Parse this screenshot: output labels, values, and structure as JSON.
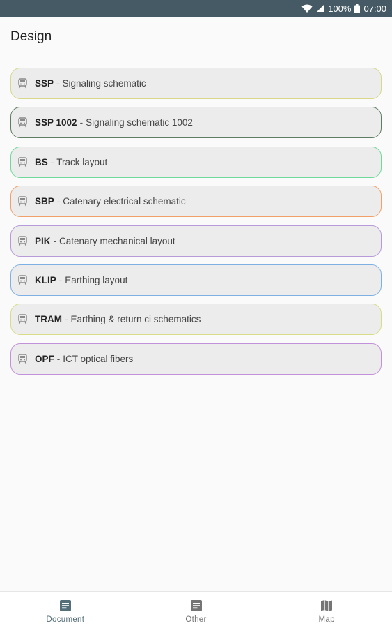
{
  "status_bar": {
    "battery": "100%",
    "time": "07:00"
  },
  "page": {
    "title": "Design"
  },
  "items": [
    {
      "code": "SSP",
      "desc": "Signaling schematic",
      "color": "#d7d88a",
      "icon": "train-icon"
    },
    {
      "code": "SSP 1002",
      "desc": "Signaling schematic 1002",
      "color": "#5f7d63",
      "icon": "train-icon"
    },
    {
      "code": "BS",
      "desc": "Track layout",
      "color": "#6ed99a",
      "icon": "train-icon"
    },
    {
      "code": "SBP",
      "desc": "Catenary electrical schematic",
      "color": "#f2a06a",
      "icon": "train-icon"
    },
    {
      "code": "PIK",
      "desc": "Catenary mechanical layout",
      "color": "#b79ad8",
      "icon": "train-icon"
    },
    {
      "code": "KLIP",
      "desc": "Earthing layout",
      "color": "#7fb0e3",
      "icon": "train-icon"
    },
    {
      "code": "TRAM",
      "desc": "Earthing & return ci schematics",
      "color": "#d9dc86",
      "icon": "train-icon"
    },
    {
      "code": "OPF",
      "desc": "ICT optical fibers",
      "color": "#c391d9",
      "icon": "train-icon"
    }
  ],
  "separator": "-",
  "bottom_nav": [
    {
      "label": "Document",
      "icon": "document-icon",
      "active": true
    },
    {
      "label": "Other",
      "icon": "list-icon",
      "active": false
    },
    {
      "label": "Map",
      "icon": "map-icon",
      "active": false
    }
  ],
  "colors": {
    "status_bar": "#455a64",
    "nav_active": "#546e7a",
    "nav_inactive": "#757575"
  }
}
